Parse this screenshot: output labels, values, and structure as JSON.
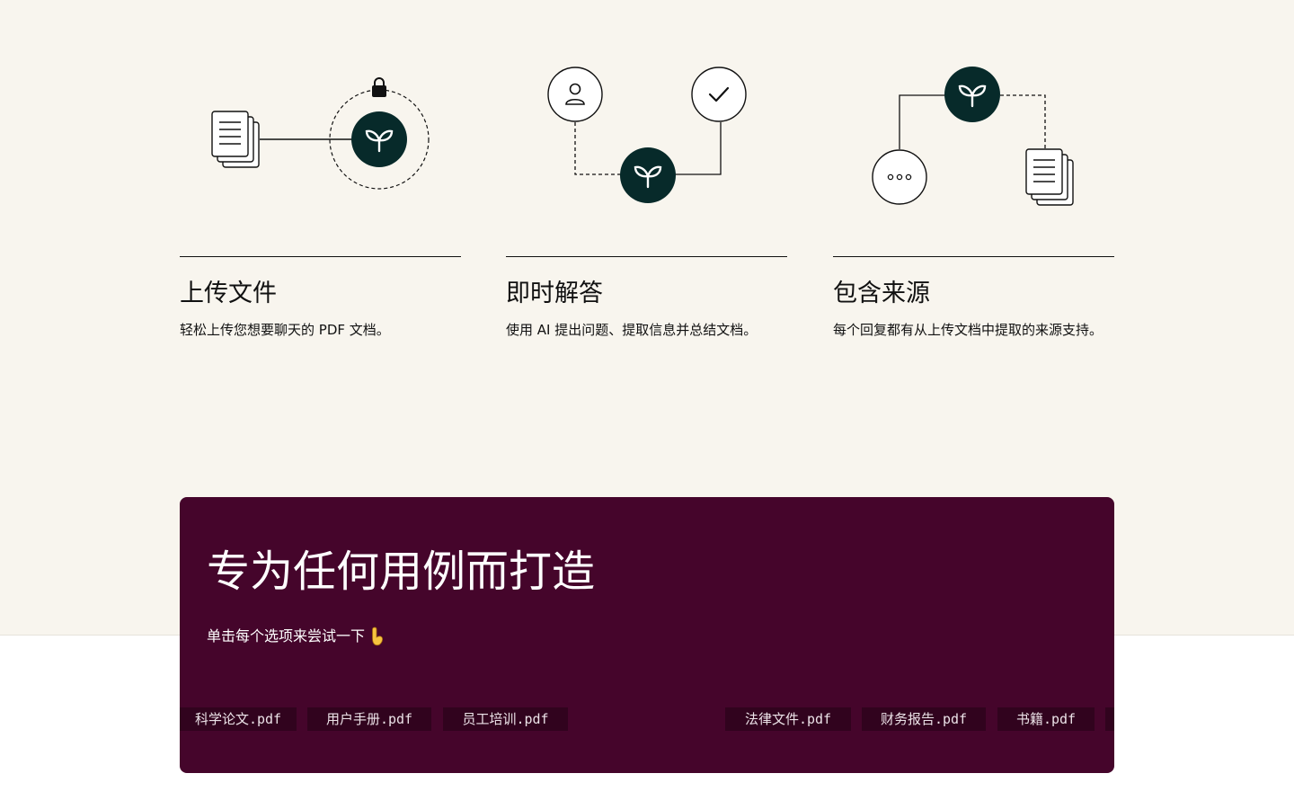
{
  "features": [
    {
      "title": "上传文件",
      "desc": "轻松上传您想要聊天的 PDF 文档。"
    },
    {
      "title": "即时解答",
      "desc": "使用 AI 提出问题、提取信息并总结文档。"
    },
    {
      "title": "包含来源",
      "desc": "每个回复都有从上传文档中提取的来源支持。"
    }
  ],
  "use_cases": {
    "title": "专为任何用例而打造",
    "hint": "单击每个选项来尝试一下",
    "hint_icon": "pointing-down-emoji",
    "chips": [
      "科学论文.pdf",
      "用户手册.pdf",
      "员工培训.pdf",
      "法律文件.pdf",
      "财务报告.pdf",
      "书籍.pdf"
    ]
  },
  "colors": {
    "cream": "#f8f5ee",
    "brand_dark_green": "#072a2a",
    "use_case_panel": "#45052b",
    "chip_bg": "#31031e"
  }
}
